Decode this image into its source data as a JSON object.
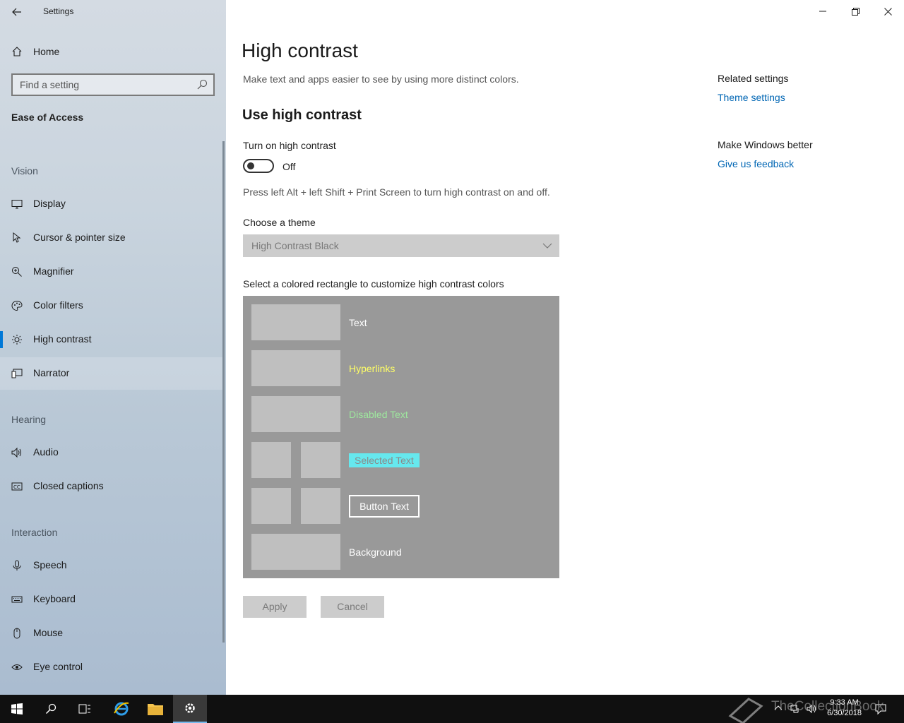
{
  "window": {
    "title": "Settings",
    "minimize_icon": "minimize-icon",
    "maximize_icon": "restore-icon",
    "close_icon": "close-icon"
  },
  "sidebar": {
    "home_label": "Home",
    "search_placeholder": "Find a setting",
    "section_title": "Ease of Access",
    "groups": [
      {
        "label": "Vision",
        "items": [
          {
            "label": "Display",
            "icon": "display-icon"
          },
          {
            "label": "Cursor & pointer size",
            "icon": "cursor-icon"
          },
          {
            "label": "Magnifier",
            "icon": "magnifier-icon"
          },
          {
            "label": "Color filters",
            "icon": "palette-icon"
          },
          {
            "label": "High contrast",
            "icon": "sun-icon",
            "selected": true
          },
          {
            "label": "Narrator",
            "icon": "narrator-icon"
          }
        ]
      },
      {
        "label": "Hearing",
        "items": [
          {
            "label": "Audio",
            "icon": "speaker-icon"
          },
          {
            "label": "Closed captions",
            "icon": "cc-icon"
          }
        ]
      },
      {
        "label": "Interaction",
        "items": [
          {
            "label": "Speech",
            "icon": "microphone-icon"
          },
          {
            "label": "Keyboard",
            "icon": "keyboard-icon"
          },
          {
            "label": "Mouse",
            "icon": "mouse-icon"
          },
          {
            "label": "Eye control",
            "icon": "eye-icon"
          }
        ]
      }
    ]
  },
  "main": {
    "title": "High contrast",
    "description": "Make text and apps easier to see by using more distinct colors.",
    "section_title": "Use high contrast",
    "toggle_label": "Turn on high contrast",
    "toggle_state": "Off",
    "toggle_on": false,
    "shortcut_hint": "Press left Alt + left Shift + Print Screen to turn high contrast on and off.",
    "theme_label": "Choose a theme",
    "theme_value": "High Contrast Black",
    "colors_label": "Select a colored rectangle to customize high contrast colors",
    "color_rows": {
      "text": "Text",
      "hyperlinks": "Hyperlinks",
      "disabled": "Disabled Text",
      "selected": "Selected Text",
      "button": "Button Text",
      "background": "Background"
    },
    "apply_label": "Apply",
    "cancel_label": "Cancel"
  },
  "related": {
    "heading": "Related settings",
    "theme_link": "Theme settings",
    "feedback_heading": "Make Windows better",
    "feedback_link": "Give us feedback"
  },
  "taskbar": {
    "time": "9:33 AM",
    "date": "6/30/2018",
    "watermark": "TheCollectionBook",
    "icons": [
      "windows-start-icon",
      "search-icon",
      "task-view-icon",
      "internet-explorer-icon",
      "file-explorer-icon",
      "settings-gear-icon"
    ]
  },
  "colors": {
    "accent": "#0078d7",
    "link": "#0066b4",
    "panel": "#999999",
    "swatch": "#bfbfbf"
  }
}
